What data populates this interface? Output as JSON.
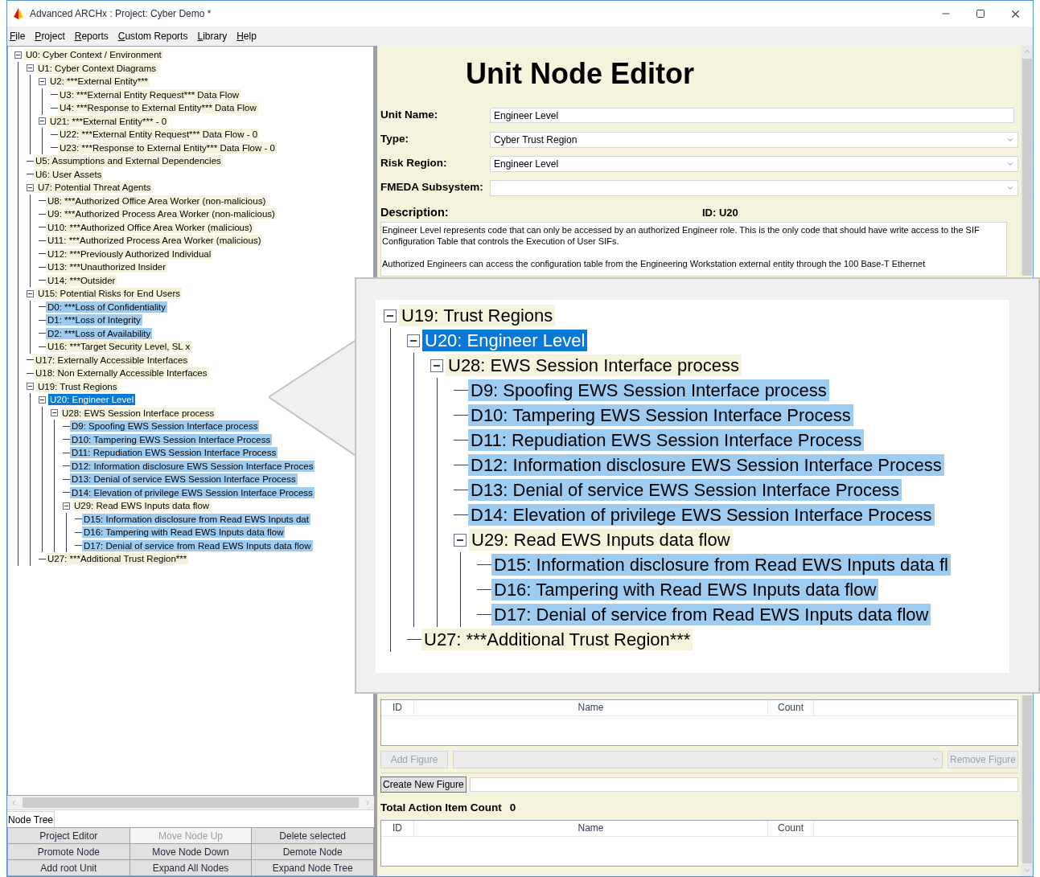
{
  "window": {
    "title": "Advanced ARCHx : Project: Cyber Demo *"
  },
  "menu": [
    "File",
    "Project",
    "Reports",
    "Custom Reports",
    "Library",
    "Help"
  ],
  "tree": [
    {
      "label": "U0: Cyber Context / Environment",
      "kind": "unit",
      "selected": false,
      "children": [
        {
          "label": "U1: Cyber Context Diagrams",
          "kind": "unit",
          "selected": false,
          "children": [
            {
              "label": "U2: ***External Entity***",
              "kind": "unit",
              "selected": false,
              "children": [
                {
                  "label": "U3: ***External Entity Request*** Data Flow",
                  "kind": "unit",
                  "selected": false
                },
                {
                  "label": "U4: ***Response to External Entity*** Data Flow",
                  "kind": "unit",
                  "selected": false
                }
              ]
            },
            {
              "label": "U21: ***External Entity*** - 0",
              "kind": "unit",
              "selected": false,
              "children": [
                {
                  "label": "U22: ***External Entity Request*** Data Flow - 0",
                  "kind": "unit",
                  "selected": false
                },
                {
                  "label": "U23: ***Response to External Entity*** Data Flow - 0",
                  "kind": "unit",
                  "selected": false
                }
              ]
            }
          ]
        },
        {
          "label": "U5: Assumptions and External Dependencies",
          "kind": "unit",
          "selected": false
        },
        {
          "label": "U6: User Assets",
          "kind": "unit",
          "selected": false
        },
        {
          "label": "U7: Potential Threat Agents",
          "kind": "unit",
          "selected": false,
          "children": [
            {
              "label": "U8: ***Authorized Office Area Worker  (non-malicious)",
              "kind": "unit",
              "selected": false
            },
            {
              "label": "U9: ***Authorized Process Area Worker (non-malicious)",
              "kind": "unit",
              "selected": false
            },
            {
              "label": "U10: ***Authorized Office Area Worker (malicious)",
              "kind": "unit",
              "selected": false
            },
            {
              "label": "U11: ***Authorized Process Area Worker (malicious)",
              "kind": "unit",
              "selected": false
            },
            {
              "label": "U12: ***Previously Authorized Individual",
              "kind": "unit",
              "selected": false
            },
            {
              "label": "U13: ***Unauthorized Insider",
              "kind": "unit",
              "selected": false
            },
            {
              "label": "U14: ***Outsider",
              "kind": "unit",
              "selected": false
            }
          ]
        },
        {
          "label": "U15: Potential Risks for End Users",
          "kind": "unit",
          "selected": false,
          "children": [
            {
              "label": "D0: ***Loss of Confidentiality",
              "kind": "risk",
              "selected": false
            },
            {
              "label": "D1: ***Loss of Integrity",
              "kind": "risk",
              "selected": false
            },
            {
              "label": "D2: ***Loss of Availability",
              "kind": "risk",
              "selected": false
            },
            {
              "label": "U16: ***Target Security Level, SL x",
              "kind": "unit",
              "selected": false
            }
          ]
        },
        {
          "label": "U17: Externally Accessible Interfaces",
          "kind": "unit",
          "selected": false
        },
        {
          "label": "U18: Non Externally Accessible Interfaces",
          "kind": "unit",
          "selected": false
        },
        {
          "label": "U19: Trust Regions",
          "kind": "unit",
          "selected": false,
          "children": [
            {
              "label": "U20: Engineer Level",
              "selected": true,
              "children": [
                {
                  "label": "U28: EWS Session Interface process",
                  "kind": "unit",
                  "selected": false,
                  "children": [
                    {
                      "label": "D9: Spoofing EWS Session Interface process",
                      "kind": "risk",
                      "selected": false
                    },
                    {
                      "label": "D10: Tampering EWS Session Interface Process",
                      "kind": "risk",
                      "selected": false
                    },
                    {
                      "label": "D11: Repudiation EWS Session Interface Process",
                      "kind": "risk",
                      "selected": false
                    },
                    {
                      "label": "D12: Information disclosure EWS Session Interface Proces",
                      "kind": "risk",
                      "selected": false
                    },
                    {
                      "label": "D13: Denial of service EWS Session Interface Process",
                      "kind": "risk",
                      "selected": false
                    },
                    {
                      "label": "D14: Elevation of privilege EWS Session Interface Process",
                      "kind": "risk",
                      "selected": false
                    },
                    {
                      "label": "U29: Read EWS Inputs data flow",
                      "kind": "unit",
                      "selected": false,
                      "children": [
                        {
                          "label": "D15: Information disclosure from Read EWS Inputs dat",
                          "kind": "risk",
                          "selected": false
                        },
                        {
                          "label": "D16: Tampering with Read EWS Inputs data flow",
                          "kind": "risk",
                          "selected": false
                        },
                        {
                          "label": "D17: Denial of service from Read EWS Inputs data flow",
                          "kind": "risk",
                          "selected": false
                        }
                      ]
                    }
                  ]
                }
              ]
            },
            {
              "label": "U27: ***Additional Trust Region***",
              "kind": "unit",
              "selected": false
            }
          ]
        }
      ]
    }
  ],
  "tree_tab": "Node Tree",
  "tree_buttons": [
    {
      "label": "Project Editor",
      "disabled": false
    },
    {
      "label": "Move Node Up",
      "disabled": true
    },
    {
      "label": "Delete selected",
      "disabled": false
    },
    {
      "label": "Promote Node",
      "disabled": false
    },
    {
      "label": "Move Node Down",
      "disabled": false
    },
    {
      "label": "Demote Node",
      "disabled": false
    },
    {
      "label": "Add root Unit",
      "disabled": false
    },
    {
      "label": "Expand All Nodes",
      "disabled": false
    },
    {
      "label": "Expand Node Tree",
      "disabled": false
    }
  ],
  "editor": {
    "title": "Unit Node Editor",
    "fields": [
      {
        "label": "Unit Name:",
        "kind": "text",
        "value": "Engineer Level"
      },
      {
        "label": "Type:",
        "kind": "select",
        "value": "Cyber Trust Region"
      },
      {
        "label": "Risk Region:",
        "kind": "select",
        "value": "Engineer Level"
      },
      {
        "label": "FMEDA Subsystem:",
        "kind": "select"
      }
    ],
    "description_label": "Description:",
    "id_label": "ID: U20",
    "description": [
      "Engineer Level represents code that can only be accessed by an authorized Engineer role.  This is the only code that should have write access to the SIF Configuration Table that controls the Execution of User SIFs.",
      "Authorized Engineers can access the configuration table from the Engineering Workstation  external entity through the 100 Base-T Ethernet"
    ],
    "figures_table": {
      "columns": [
        "ID",
        "Name",
        "Count"
      ]
    },
    "add_figure_button": {
      "label": "Add Figure",
      "disabled": true
    },
    "remove_figure_button": {
      "label": "Remove Figure",
      "disabled": true
    },
    "create_figure_button": {
      "label": "Create New Figure",
      "disabled": false
    },
    "action_items": {
      "label": "Total Action Item Count",
      "count": "0",
      "columns": [
        "ID",
        "Name",
        "Count"
      ]
    }
  },
  "callout": {
    "tree": [
      {
        "label": "U19: Trust Regions",
        "kind": "unit",
        "selected": false,
        "children": [
          {
            "label": "U20: Engineer Level",
            "selected": true,
            "children": [
              {
                "label": "U28: EWS Session Interface process",
                "kind": "unit",
                "selected": false,
                "children": [
                  {
                    "label": "D9: Spoofing EWS Session Interface process",
                    "kind": "risk",
                    "selected": false
                  },
                  {
                    "label": "D10: Tampering EWS Session Interface Process",
                    "kind": "risk",
                    "selected": false
                  },
                  {
                    "label": "D11: Repudiation EWS Session Interface Process",
                    "kind": "risk",
                    "selected": false
                  },
                  {
                    "label": "D12: Information disclosure EWS Session Interface Process",
                    "kind": "risk",
                    "selected": false
                  },
                  {
                    "label": "D13: Denial of service EWS Session Interface Process",
                    "kind": "risk",
                    "selected": false
                  },
                  {
                    "label": "D14: Elevation of privilege EWS Session Interface Process",
                    "kind": "risk",
                    "selected": false
                  },
                  {
                    "label": "U29: Read EWS Inputs data flow",
                    "kind": "unit",
                    "selected": false,
                    "children": [
                      {
                        "label": "D15: Information disclosure from Read EWS Inputs data fl",
                        "kind": "risk",
                        "selected": false
                      },
                      {
                        "label": "D16: Tampering with Read EWS Inputs data flow",
                        "kind": "risk",
                        "selected": false
                      },
                      {
                        "label": "D17: Denial of service from Read EWS Inputs data flow",
                        "kind": "risk",
                        "selected": false
                      }
                    ]
                  }
                ]
              }
            ]
          },
          {
            "label": "U27: ***Additional Trust Region***",
            "kind": "unit",
            "selected": false
          }
        ]
      }
    ]
  }
}
